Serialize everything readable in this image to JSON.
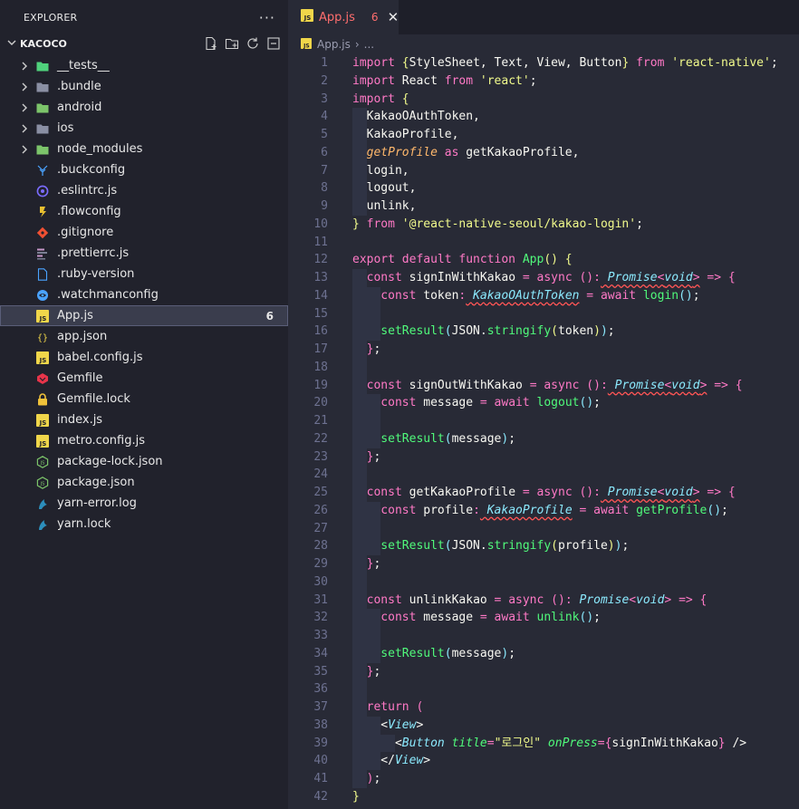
{
  "explorer": {
    "title": "EXPLORER",
    "more": "···",
    "project": "KACOCO",
    "items": [
      {
        "label": "__tests__",
        "kind": "folder",
        "icon": "test-folder-icon",
        "color": "#4fd17c"
      },
      {
        "label": ".bundle",
        "kind": "folder",
        "icon": "folder-icon",
        "color": "#8a8fa3"
      },
      {
        "label": "android",
        "kind": "folder",
        "icon": "android-folder-icon",
        "color": "#7cc46a"
      },
      {
        "label": "ios",
        "kind": "folder",
        "icon": "ios-folder-icon",
        "color": "#8a8fa3"
      },
      {
        "label": "node_modules",
        "kind": "folder",
        "icon": "node-folder-icon",
        "color": "#7cc46a"
      },
      {
        "label": ".buckconfig",
        "kind": "file",
        "icon": "buck-icon",
        "color": "#4aa3ff"
      },
      {
        "label": ".eslintrc.js",
        "kind": "file",
        "icon": "eslint-icon",
        "color": "#7b6cff"
      },
      {
        "label": ".flowconfig",
        "kind": "file",
        "icon": "flow-icon",
        "color": "#e8bf30"
      },
      {
        "label": ".gitignore",
        "kind": "file",
        "icon": "git-icon",
        "color": "#f05033"
      },
      {
        "label": ".prettierrc.js",
        "kind": "file",
        "icon": "prettier-icon",
        "color": "#c596c7"
      },
      {
        "label": ".ruby-version",
        "kind": "file",
        "icon": "file-icon",
        "color": "#4aa3ff"
      },
      {
        "label": ".watchmanconfig",
        "kind": "file",
        "icon": "watchman-icon",
        "color": "#4aa3ff"
      },
      {
        "label": "App.js",
        "kind": "file",
        "icon": "js-icon",
        "color": "#f0d64a",
        "badge": "6",
        "selected": true
      },
      {
        "label": "app.json",
        "kind": "file",
        "icon": "json-icon",
        "color": "#f0d64a"
      },
      {
        "label": "babel.config.js",
        "kind": "file",
        "icon": "babel-icon",
        "color": "#f0d64a"
      },
      {
        "label": "Gemfile",
        "kind": "file",
        "icon": "gem-icon",
        "color": "#e8344a"
      },
      {
        "label": "Gemfile.lock",
        "kind": "file",
        "icon": "lock-icon",
        "color": "#f0c23a"
      },
      {
        "label": "index.js",
        "kind": "file",
        "icon": "js-icon",
        "color": "#f0d64a"
      },
      {
        "label": "metro.config.js",
        "kind": "file",
        "icon": "js-icon",
        "color": "#f0d64a"
      },
      {
        "label": "package-lock.json",
        "kind": "file",
        "icon": "npm-icon",
        "color": "#7cc46a"
      },
      {
        "label": "package.json",
        "kind": "file",
        "icon": "npm-icon",
        "color": "#7cc46a"
      },
      {
        "label": "yarn-error.log",
        "kind": "file",
        "icon": "yarn-icon",
        "color": "#2c8ebb"
      },
      {
        "label": "yarn.lock",
        "kind": "file",
        "icon": "yarn-icon",
        "color": "#2c8ebb"
      }
    ]
  },
  "editor": {
    "tab": {
      "name": "App.js",
      "badge": "6",
      "close": "✕"
    },
    "breadcrumb": {
      "file": "App.js",
      "separator": "›",
      "rest": "..."
    },
    "lines": [
      [
        [
          "k",
          "import"
        ],
        [
          "b1",
          " {"
        ],
        [
          "pu",
          "StyleSheet, Text, View, Button"
        ],
        [
          "b1",
          "}"
        ],
        [
          "k",
          " from"
        ],
        [
          "s",
          " 'react-native'"
        ],
        [
          "pu",
          ";"
        ]
      ],
      [
        [
          "k",
          "import"
        ],
        [
          "pu",
          " React"
        ],
        [
          "k",
          " from"
        ],
        [
          "s",
          " 'react'"
        ],
        [
          "pu",
          ";"
        ]
      ],
      [
        [
          "k",
          "import"
        ],
        [
          "b1",
          " {"
        ]
      ],
      [
        [
          "pu",
          "  KakaoOAuthToken,"
        ]
      ],
      [
        [
          "pu",
          "  KakaoProfile,"
        ]
      ],
      [
        [
          "p",
          "  getProfile"
        ],
        [
          "k",
          " as"
        ],
        [
          "pu",
          " getKakaoProfile,"
        ]
      ],
      [
        [
          "pu",
          "  login,"
        ]
      ],
      [
        [
          "pu",
          "  logout,"
        ]
      ],
      [
        [
          "pu",
          "  unlink,"
        ]
      ],
      [
        [
          "b1",
          "}"
        ],
        [
          "k",
          " from"
        ],
        [
          "s",
          " '@react-native-seoul/kakao-login'"
        ],
        [
          "pu",
          ";"
        ]
      ],
      [],
      [
        [
          "k",
          "export default function"
        ],
        [
          "f",
          " App"
        ],
        [
          "b1",
          "()"
        ],
        [
          "b1",
          " {"
        ]
      ],
      [
        [
          "k",
          "  const"
        ],
        [
          "pu",
          " signInWithKakao "
        ],
        [
          "k",
          "="
        ],
        [
          "k",
          " async"
        ],
        [
          "b2",
          " ()"
        ],
        [
          "k",
          ":"
        ],
        [
          "t err",
          " Promise"
        ],
        [
          "k err",
          "<"
        ],
        [
          "t err",
          "void"
        ],
        [
          "k err",
          ">"
        ],
        [
          "k",
          " =>"
        ],
        [
          "b2",
          " {"
        ]
      ],
      [
        [
          "k",
          "    const"
        ],
        [
          "pu",
          " token"
        ],
        [
          "k",
          ":"
        ],
        [
          "t err",
          " KakaoOAuthToken"
        ],
        [
          "k",
          " ="
        ],
        [
          "k",
          " await"
        ],
        [
          "f",
          " login"
        ],
        [
          "b3",
          "()"
        ],
        [
          "pu",
          ";"
        ]
      ],
      [],
      [
        [
          "f",
          "    setResult"
        ],
        [
          "b3",
          "("
        ],
        [
          "pu",
          "JSON."
        ],
        [
          "f",
          "stringify"
        ],
        [
          "b1",
          "("
        ],
        [
          "pu",
          "token"
        ],
        [
          "b1",
          ")"
        ],
        [
          "b3",
          ")"
        ],
        [
          "pu",
          ";"
        ]
      ],
      [
        [
          "b2",
          "  }"
        ],
        [
          "pu",
          ";"
        ]
      ],
      [],
      [
        [
          "k",
          "  const"
        ],
        [
          "pu",
          " signOutWithKakao "
        ],
        [
          "k",
          "="
        ],
        [
          "k",
          " async"
        ],
        [
          "b2",
          " ()"
        ],
        [
          "k",
          ":"
        ],
        [
          "t err",
          " Promise"
        ],
        [
          "k err",
          "<"
        ],
        [
          "t err",
          "void"
        ],
        [
          "k err",
          ">"
        ],
        [
          "k",
          " =>"
        ],
        [
          "b2",
          " {"
        ]
      ],
      [
        [
          "k",
          "    const"
        ],
        [
          "pu",
          " message "
        ],
        [
          "k",
          "="
        ],
        [
          "k",
          " await"
        ],
        [
          "f",
          " logout"
        ],
        [
          "b3",
          "()"
        ],
        [
          "pu",
          ";"
        ]
      ],
      [],
      [
        [
          "f",
          "    setResult"
        ],
        [
          "b3",
          "("
        ],
        [
          "pu",
          "message"
        ],
        [
          "b3",
          ")"
        ],
        [
          "pu",
          ";"
        ]
      ],
      [
        [
          "b2",
          "  }"
        ],
        [
          "pu",
          ";"
        ]
      ],
      [],
      [
        [
          "k",
          "  const"
        ],
        [
          "pu",
          " getKakaoProfile "
        ],
        [
          "k",
          "="
        ],
        [
          "k",
          " async"
        ],
        [
          "b2",
          " ()"
        ],
        [
          "k",
          ":"
        ],
        [
          "t err",
          " Promise"
        ],
        [
          "k err",
          "<"
        ],
        [
          "t err",
          "void"
        ],
        [
          "k err",
          ">"
        ],
        [
          "k",
          " =>"
        ],
        [
          "b2",
          " {"
        ]
      ],
      [
        [
          "k",
          "    const"
        ],
        [
          "pu",
          " profile"
        ],
        [
          "k",
          ":"
        ],
        [
          "t err",
          " KakaoProfile"
        ],
        [
          "k",
          " ="
        ],
        [
          "k",
          " await"
        ],
        [
          "f",
          " getProfile"
        ],
        [
          "b3",
          "()"
        ],
        [
          "pu",
          ";"
        ]
      ],
      [],
      [
        [
          "f",
          "    setResult"
        ],
        [
          "b3",
          "("
        ],
        [
          "pu",
          "JSON."
        ],
        [
          "f",
          "stringify"
        ],
        [
          "b1",
          "("
        ],
        [
          "pu",
          "profile"
        ],
        [
          "b1",
          ")"
        ],
        [
          "b3",
          ")"
        ],
        [
          "pu",
          ";"
        ]
      ],
      [
        [
          "b2",
          "  }"
        ],
        [
          "pu",
          ";"
        ]
      ],
      [],
      [
        [
          "k",
          "  const"
        ],
        [
          "pu",
          " unlinkKakao "
        ],
        [
          "k",
          "="
        ],
        [
          "k",
          " async"
        ],
        [
          "b2",
          " ()"
        ],
        [
          "k",
          ":"
        ],
        [
          "t",
          " Promise"
        ],
        [
          "k",
          "<"
        ],
        [
          "t",
          "void"
        ],
        [
          "k",
          ">"
        ],
        [
          "k",
          " =>"
        ],
        [
          "b2",
          " {"
        ]
      ],
      [
        [
          "k",
          "    const"
        ],
        [
          "pu",
          " message "
        ],
        [
          "k",
          "="
        ],
        [
          "k",
          " await"
        ],
        [
          "f",
          " unlink"
        ],
        [
          "b3",
          "()"
        ],
        [
          "pu",
          ";"
        ]
      ],
      [],
      [
        [
          "f",
          "    setResult"
        ],
        [
          "b3",
          "("
        ],
        [
          "pu",
          "message"
        ],
        [
          "b3",
          ")"
        ],
        [
          "pu",
          ";"
        ]
      ],
      [
        [
          "b2",
          "  }"
        ],
        [
          "pu",
          ";"
        ]
      ],
      [],
      [
        [
          "k",
          "  return"
        ],
        [
          "b2",
          " ("
        ]
      ],
      [
        [
          "pu",
          "    <"
        ],
        [
          "t",
          "View"
        ],
        [
          "pu",
          ">"
        ]
      ],
      [
        [
          "pu",
          "      <"
        ],
        [
          "t",
          "Button"
        ],
        [
          "a",
          " title"
        ],
        [
          "k",
          "="
        ],
        [
          "s",
          "\"로그인\""
        ],
        [
          "a",
          " onPress"
        ],
        [
          "k",
          "="
        ],
        [
          "k",
          "{"
        ],
        [
          "pu",
          "signInWithKakao"
        ],
        [
          "k",
          "}"
        ],
        [
          "pu",
          " />"
        ]
      ],
      [
        [
          "pu",
          "    </"
        ],
        [
          "t",
          "View"
        ],
        [
          "pu",
          ">"
        ]
      ],
      [
        [
          "b2",
          "  )"
        ],
        [
          "pu",
          ";"
        ]
      ],
      [
        [
          "b1",
          "}"
        ]
      ]
    ]
  }
}
